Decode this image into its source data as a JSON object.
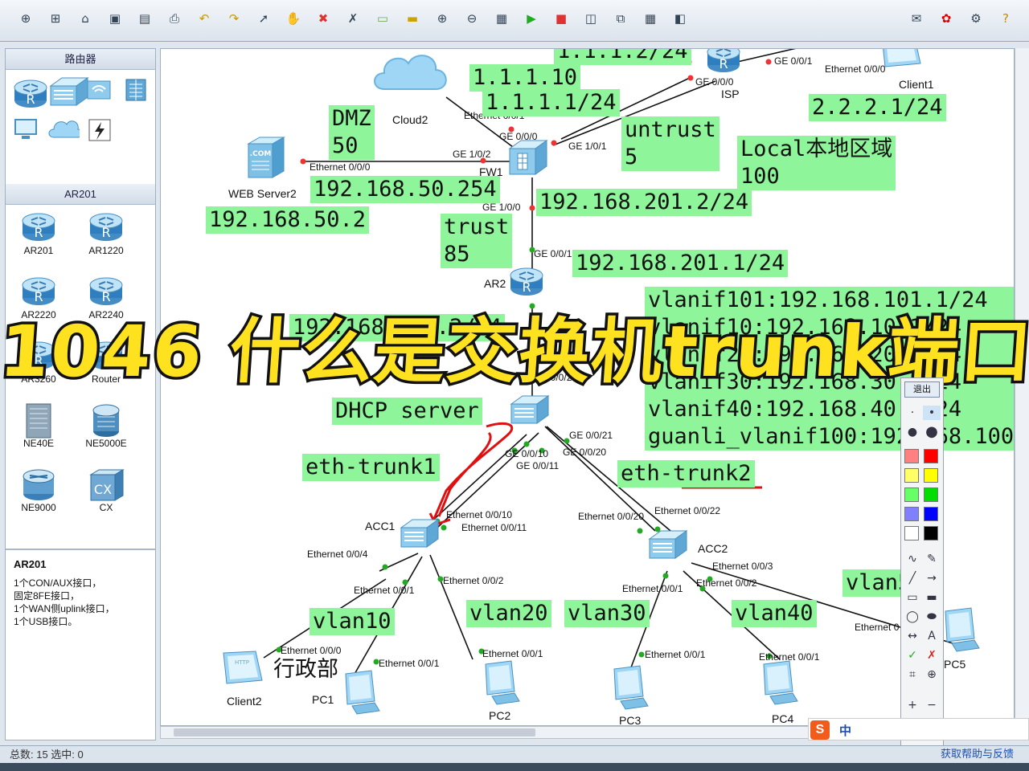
{
  "toolbar": {
    "tools": [
      "new-topo-icon",
      "new-page-icon",
      "open-icon",
      "save-icon",
      "save-as-icon",
      "print-icon",
      "undo-icon",
      "redo-icon",
      "select-icon",
      "hand-icon",
      "delete-icon",
      "delete-link-icon",
      "text-icon",
      "rectangle-icon",
      "zoom-in-icon",
      "zoom-out-icon",
      "ok-icon",
      "start-icon",
      "stop-icon",
      "capture-icon",
      "topology-icon",
      "grid-icon",
      "console-icon"
    ],
    "right_tools": [
      "message-icon",
      "huawei-icon",
      "settings-icon",
      "help-icon"
    ]
  },
  "left_panel": {
    "section1_title": "路由器",
    "section2_title": "AR201",
    "category_icons": [
      "router-category-icon",
      "switch-category-icon",
      "wireless-category-icon",
      "firewall-category-icon",
      "terminal-category-icon",
      "cloud-category-icon",
      "link-category-icon"
    ],
    "devices": [
      {
        "name": "AR201"
      },
      {
        "name": "AR1220"
      },
      {
        "name": "AR2220"
      },
      {
        "name": "AR2240"
      },
      {
        "name": "AR3260"
      },
      {
        "name": "Router"
      },
      {
        "name": "NE40E"
      },
      {
        "name": "NE5000E"
      },
      {
        "name": "NE9000"
      },
      {
        "name": "CX"
      }
    ],
    "info_title": "AR201",
    "info_lines": [
      "1个CON/AUX接口，",
      "固定8FE接口，",
      "1个WAN侧uplink接口，",
      "1个USB接口。"
    ]
  },
  "topology": {
    "nodes": {
      "cloud2": "Cloud2",
      "isp": "ISP",
      "client1": "Client1",
      "fw1": "FW1",
      "web_server2": "WEB Server2",
      "ar2": "AR2",
      "acc1": "ACC1",
      "acc2": "ACC2",
      "client2": "Client2",
      "pc1": "PC1",
      "pc2": "PC2",
      "pc3": "PC3",
      "pc4": "PC4",
      "pc5": "PC5"
    },
    "ports": {
      "isp_ge000_top": "GE 0/0/1",
      "client1_eth": "Ethernet 0/0/0",
      "isp_ge000": "GE 0/0/0",
      "cloud_eth": "Ethernet 0/0/1",
      "fw_ge000": "GE 0/0/0",
      "fw_ge101": "GE 1/0/1",
      "fw_ge102": "GE 1/0/2",
      "web_eth": "Ethernet 0/0/0",
      "fw_ge100": "GE 1/0/0",
      "ar2_ge001": "GE 0/0/1",
      "ar2_ge002": "GE 0/0/2",
      "sw_ge0010": "GE 0/0/10",
      "sw_ge0011": "GE 0/0/11",
      "sw_ge0021": "GE 0/0/21",
      "sw_ge0020": "GE 0/0/20",
      "acc1_eth0010": "Ethernet 0/0/10",
      "acc1_eth0011": "Ethernet 0/0/11",
      "acc1_eth004": "Ethernet 0/0/4",
      "acc1_eth001": "Ethernet 0/0/1",
      "acc1_eth002": "Ethernet 0/0/2",
      "acc2_eth0020": "Ethernet 0/0/20",
      "acc2_eth0022": "Ethernet 0/0/22",
      "acc2_eth003": "Ethernet 0/0/3",
      "acc2_eth001": "Ethernet 0/0/1",
      "acc2_eth002": "Ethernet 0/0/2",
      "client2_eth": "Ethernet 0/0/0",
      "pc1_eth": "Ethernet 0/0/1",
      "pc2_eth": "Ethernet 0/0/1",
      "pc3_eth": "Ethernet 0/0/1",
      "pc4_eth": "Ethernet 0/0/1",
      "pc5_eth": "Ethernet 0"
    },
    "notes": {
      "isp_ip_top": "1.1.1.2/24",
      "cloud_ip": "1.1.1.10",
      "fw_ip": "1.1.1.1/24",
      "client1_ip": "2.2.2.1/24",
      "dmz": "DMZ\n50",
      "untrust": "untrust\n5",
      "local": "Local本地区域\n100",
      "fw_gw50": "192.168.50.254",
      "web_ip": "192.168.50.2",
      "trust": "trust\n85",
      "fw_ip201": "192.168.201.2/24",
      "ar2_ip201": "192.168.201.1/24",
      "vlanif_list": "vlanif101:192.168.101.1/24\nvlanif10:192.168.10.1/24\nvlanif20:192.168.20.1/24\nvlanif30:192.168.30.1/24\nvlanif40:192.168.40.1/24\nguanli_vlanif100:192.168.100",
      "ar2_ip101": "192.168.101.2/24",
      "dhcp": "DHCP server",
      "eth_trunk1": "eth-trunk1",
      "eth_trunk2": "eth-trunk2",
      "vlan10": "vlan10",
      "vlan20": "vlan20",
      "vlan30": "vlan30",
      "vlan40": "vlan40",
      "vlan_pc5": "vlan50",
      "dept": "行政部"
    }
  },
  "banner": "1046 什么是交换机trunk端口",
  "palette": {
    "exit_label": "退出",
    "colors": [
      "#ff8080",
      "#ff0000",
      "#ffff66",
      "#ffff00",
      "#66ff66",
      "#00dd00",
      "#8080ff",
      "#0000ff",
      "#ffffff",
      "#000000"
    ]
  },
  "status": {
    "text": "总数: 15  选中: 0",
    "help_link": "获取帮助与反馈"
  },
  "ime": {
    "label": "中"
  }
}
